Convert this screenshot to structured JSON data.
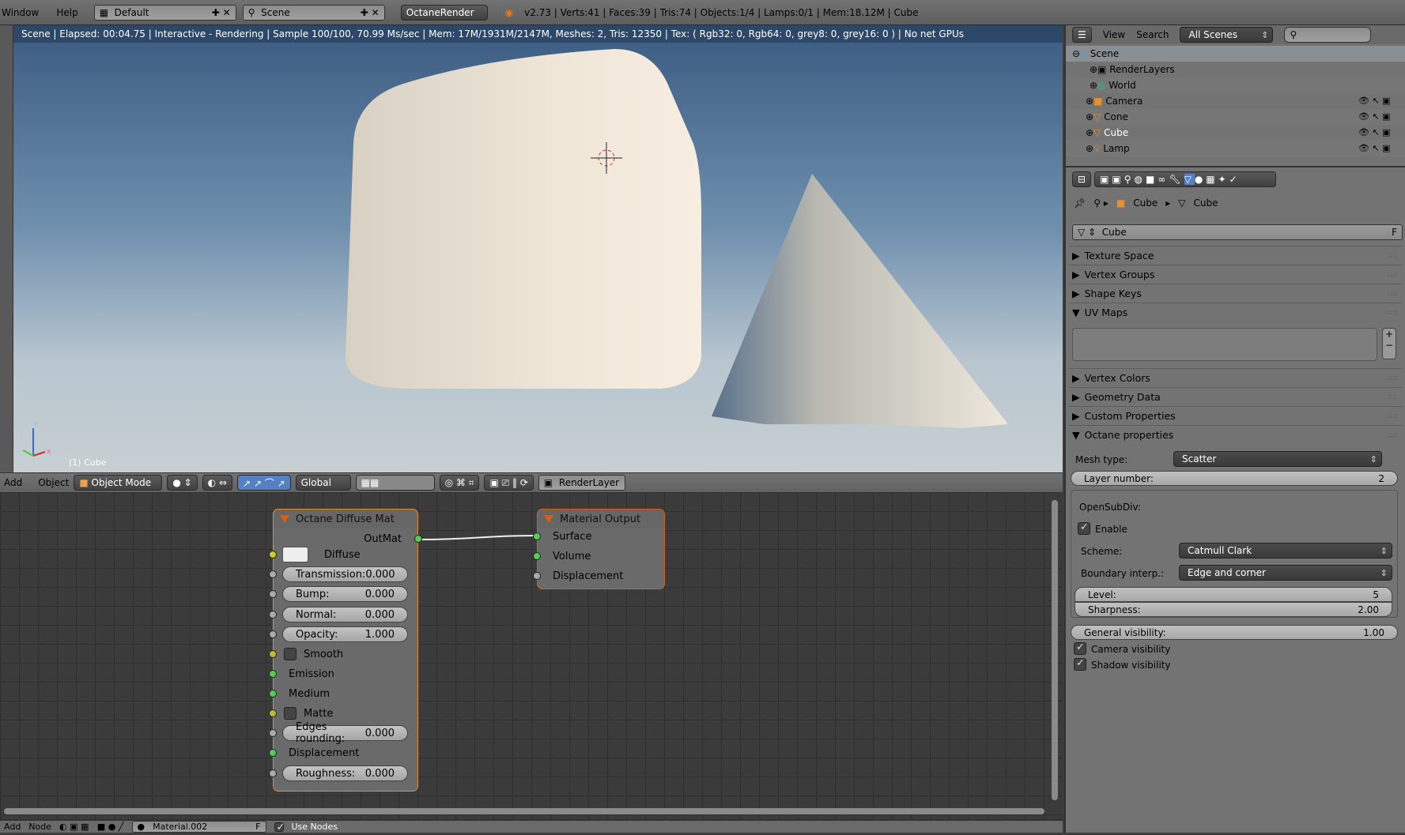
{
  "topbar": {
    "menus": [
      "Window",
      "Help"
    ],
    "layout": "Default",
    "scene": "Scene",
    "engine": "OctaneRender",
    "stats": "v2.73 | Verts:41 | Faces:39 | Tris:74 | Objects:1/4 | Lamps:0/1 | Mem:18.12M | Cube"
  },
  "viewport": {
    "status": "Scene | Elapsed: 00:04.75 | Interactive - Rendering | Sample 100/100, 70.99 Ms/sec | Mem: 17M/1931M/2147M, Meshes: 2, Tris: 12350 | Tex: ( Rgb32: 0, Rgb64: 0, grey8: 0, grey16: 0 ) | No net GPUs",
    "object_label": "(1) Cube",
    "axes": {
      "x": "x",
      "z": "z"
    }
  },
  "header3d": {
    "add": "Add",
    "object": "Object",
    "mode": "Object Mode",
    "orientation": "Global",
    "render_layer": "RenderLayer"
  },
  "nodes": {
    "diffuse": {
      "title": "Octane Diffuse Mat",
      "output": "OutMat",
      "diffuse": "Diffuse",
      "transmission": {
        "label": "Transmission:",
        "value": "0.000"
      },
      "bump": {
        "label": "Bump:",
        "value": "0.000"
      },
      "normal": {
        "label": "Normal:",
        "value": "0.000"
      },
      "opacity": {
        "label": "Opacity:",
        "value": "1.000"
      },
      "smooth": "Smooth",
      "emission": "Emission",
      "medium": "Medium",
      "matte": "Matte",
      "edges": {
        "label": "Edges rounding:",
        "value": "0.000"
      },
      "displacement": "Displacement",
      "roughness": {
        "label": "Roughness:",
        "value": "0.000"
      }
    },
    "output": {
      "title": "Material Output",
      "surface": "Surface",
      "volume": "Volume",
      "displacement": "Displacement"
    }
  },
  "nodeheader": {
    "add": "Add",
    "node": "Node",
    "material": "Material.002",
    "fake": "F",
    "use_nodes": "Use Nodes",
    "use_nodes_checked": true
  },
  "outliner": {
    "view": "View",
    "search": "Search",
    "filter": "All Scenes",
    "search_placeholder": "",
    "items": [
      {
        "label": "Scene"
      },
      {
        "label": "RenderLayers"
      },
      {
        "label": "World"
      },
      {
        "label": "Camera"
      },
      {
        "label": "Cone"
      },
      {
        "label": "Cube"
      },
      {
        "label": "Lamp"
      }
    ]
  },
  "properties": {
    "breadcrumb": [
      "Cube",
      "Cube"
    ],
    "mesh_name": "Cube",
    "fake": "F",
    "panels": [
      "Texture Space",
      "Vertex Groups",
      "Shape Keys",
      "UV Maps",
      "Vertex Colors",
      "Geometry Data",
      "Custom Properties",
      "Octane properties"
    ],
    "mesh_type": {
      "label": "Mesh type:",
      "value": "Scatter"
    },
    "layer_number": {
      "label": "Layer number:",
      "value": "2"
    },
    "opensubdiv": {
      "title": "OpenSubDiv:",
      "enable": "Enable",
      "enable_checked": true,
      "scheme": {
        "label": "Scheme:",
        "value": "Catmull Clark"
      },
      "boundary": {
        "label": "Boundary interp.:",
        "value": "Edge and corner"
      },
      "level": {
        "label": "Level:",
        "value": "5"
      },
      "sharpness": {
        "label": "Sharpness:",
        "value": "2.00"
      }
    },
    "general_visibility": {
      "label": "General visibility:",
      "value": "1.00"
    },
    "camera_visibility": "Camera visibility",
    "camera_checked": true,
    "shadow_visibility": "Shadow visibility",
    "shadow_checked": true
  }
}
